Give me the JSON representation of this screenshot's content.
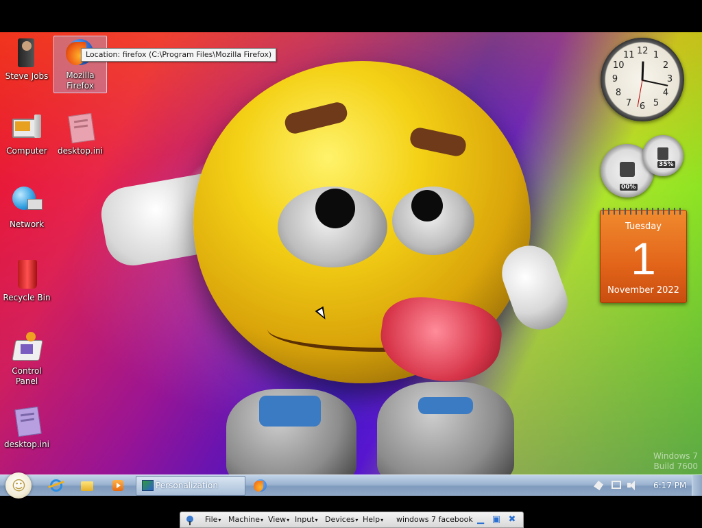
{
  "desktop": {
    "icons": [
      {
        "label": "Steve Jobs",
        "icon": "user-folder-icon"
      },
      {
        "label": "Mozilla Firefox",
        "icon": "firefox-icon"
      },
      {
        "label": "Computer",
        "icon": "computer-icon"
      },
      {
        "label": "desktop.ini",
        "icon": "config-file-icon"
      },
      {
        "label": "Network",
        "icon": "network-icon"
      },
      {
        "label": "Recycle Bin",
        "icon": "recycle-bin-icon"
      },
      {
        "label": "Control Panel",
        "icon": "control-panel-icon"
      },
      {
        "label": "desktop.ini",
        "icon": "config-file-icon"
      }
    ],
    "tooltip": "Location: firefox (C:\\Program Files\\Mozilla Firefox)",
    "watermark_line1": "Windows 7",
    "watermark_line2": "Build 7600"
  },
  "gadgets": {
    "clock_numbers": [
      "12",
      "1",
      "2",
      "3",
      "4",
      "5",
      "6",
      "7",
      "8",
      "9",
      "10",
      "11"
    ],
    "cpu_meter_value": "00%",
    "memory_meter_value": "35%",
    "calendar": {
      "day": "Tuesday",
      "date": "1",
      "month": "November 2022"
    }
  },
  "taskbar": {
    "quick_launch": [
      "internet-explorer-icon",
      "folder-icon",
      "media-player-icon"
    ],
    "active_window": "Personalization",
    "pinned": [
      "firefox-icon"
    ],
    "time": "6:17 PM"
  },
  "vbox_bar": {
    "menus": [
      "File",
      "Machine",
      "View",
      "Input",
      "Devices",
      "Help"
    ],
    "title": "windows 7 facebook"
  }
}
